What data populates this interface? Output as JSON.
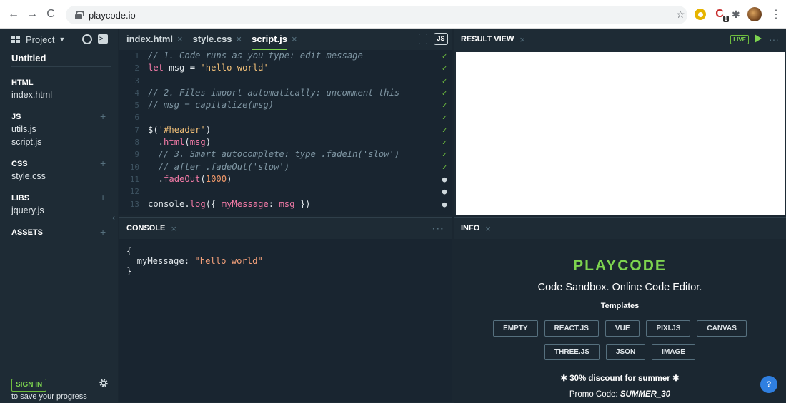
{
  "browser": {
    "url": "playcode.io"
  },
  "sidebar": {
    "project_label": "Project",
    "project_name": "Untitled",
    "sections": [
      {
        "title": "HTML",
        "files": [
          "index.html"
        ]
      },
      {
        "title": "JS",
        "files": [
          "utils.js",
          "script.js"
        ]
      },
      {
        "title": "CSS",
        "files": [
          "style.css"
        ]
      },
      {
        "title": "LIBS",
        "files": [
          "jquery.js"
        ]
      },
      {
        "title": "ASSETS",
        "files": []
      }
    ],
    "signin_label": "SIGN IN",
    "save_text": "to save your progress"
  },
  "editor": {
    "tabs": [
      {
        "label": "index.html",
        "active": false
      },
      {
        "label": "style.css",
        "active": false
      },
      {
        "label": "script.js",
        "active": true
      }
    ],
    "lang_badge": "JS",
    "lines": [
      {
        "n": "1",
        "status": "ok",
        "parts": [
          [
            "cm",
            "// 1. Code runs as you type: edit message"
          ]
        ]
      },
      {
        "n": "2",
        "status": "ok",
        "parts": [
          [
            "kw",
            "let "
          ],
          [
            "plain",
            "msg = "
          ],
          [
            "str",
            "'hello world'"
          ]
        ]
      },
      {
        "n": "3",
        "status": "ok",
        "parts": []
      },
      {
        "n": "4",
        "status": "ok",
        "parts": [
          [
            "cm",
            "// 2. Files import automatically: uncomment this"
          ]
        ]
      },
      {
        "n": "5",
        "status": "ok",
        "parts": [
          [
            "cm",
            "// msg = capitalize(msg)"
          ]
        ]
      },
      {
        "n": "6",
        "status": "ok",
        "parts": []
      },
      {
        "n": "7",
        "status": "ok",
        "parts": [
          [
            "plain",
            "$("
          ],
          [
            "str",
            "'#header'"
          ],
          [
            "plain",
            ")"
          ]
        ]
      },
      {
        "n": "8",
        "status": "ok",
        "parts": [
          [
            "plain",
            "  ."
          ],
          [
            "fn",
            "html"
          ],
          [
            "plain",
            "("
          ],
          [
            "fn",
            "msg"
          ],
          [
            "plain",
            ")"
          ]
        ]
      },
      {
        "n": "9",
        "status": "ok",
        "parts": [
          [
            "cm",
            "  // 3. Smart autocomplete: type .fadeIn('slow')"
          ]
        ]
      },
      {
        "n": "10",
        "status": "ok",
        "parts": [
          [
            "cm",
            "  // after .fadeOut('slow')"
          ]
        ]
      },
      {
        "n": "11",
        "status": "q",
        "parts": [
          [
            "plain",
            "  ."
          ],
          [
            "fn",
            "fadeOut"
          ],
          [
            "plain",
            "("
          ],
          [
            "num",
            "1000"
          ],
          [
            "plain",
            ")"
          ]
        ]
      },
      {
        "n": "12",
        "status": "q",
        "parts": []
      },
      {
        "n": "13",
        "status": "q",
        "parts": [
          [
            "plain",
            "console."
          ],
          [
            "fn",
            "log"
          ],
          [
            "plain",
            "({ "
          ],
          [
            "fn",
            "myMessage"
          ],
          [
            "plain",
            ": "
          ],
          [
            "fn",
            "msg"
          ],
          [
            "plain",
            " })"
          ]
        ]
      }
    ]
  },
  "console": {
    "title": "CONSOLE",
    "output_open": "{",
    "output_key": "  myMessage: ",
    "output_value": "\"hello world\"",
    "output_close": "}"
  },
  "result": {
    "title": "RESULT VIEW",
    "live_label": "LIVE"
  },
  "info": {
    "title": "INFO",
    "logo": "PLAYCODE",
    "subtitle": "Code Sandbox. Online Code Editor.",
    "templates_title": "Templates",
    "templates_row1": [
      "EMPTY",
      "REACT.JS",
      "VUE",
      "PIXI.JS",
      "CANVAS"
    ],
    "templates_row2": [
      "THREE.JS",
      "JSON",
      "IMAGE"
    ],
    "promo_line": "✱ 30% discount for summer ✱",
    "promo_label": "Promo Code: ",
    "promo_code": "SUMMER_30"
  },
  "help_label": "?"
}
